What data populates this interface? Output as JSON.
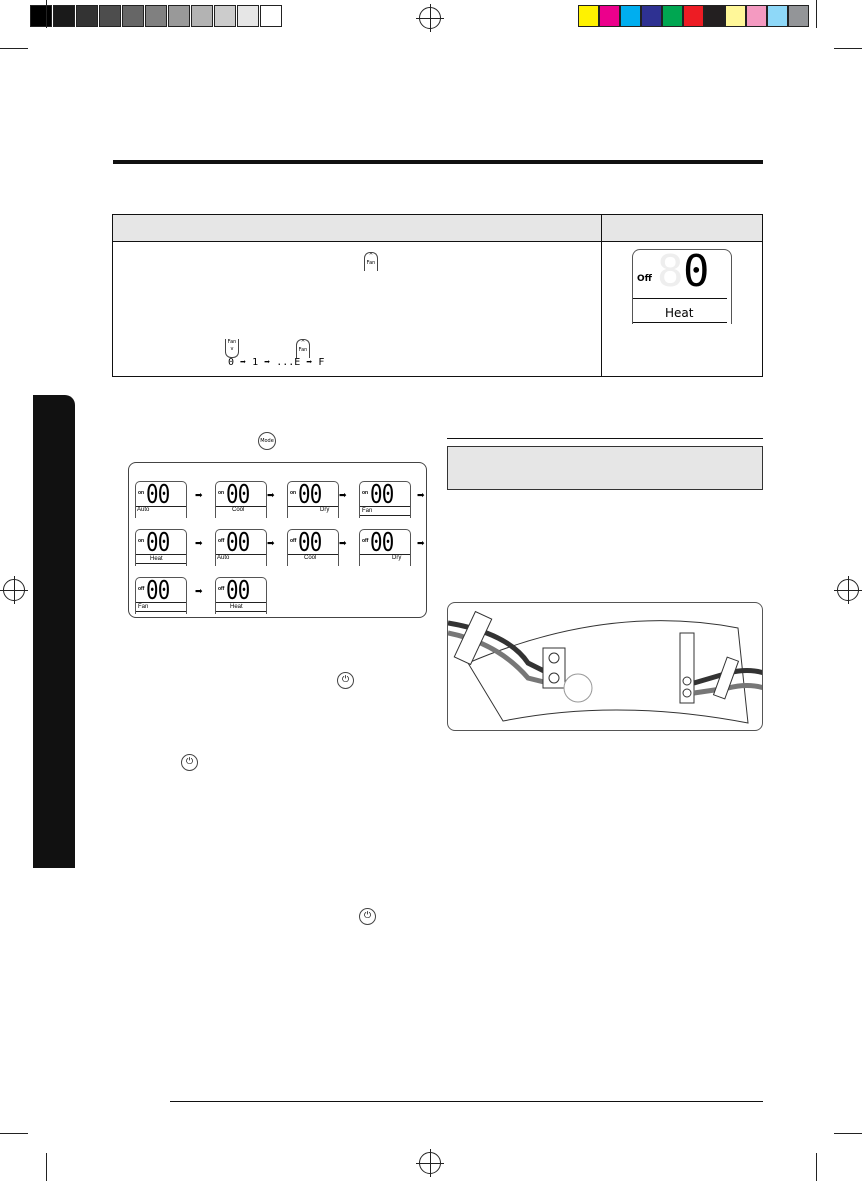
{
  "colors": {
    "gray": [
      "#000000",
      "#1a1a1a",
      "#333333",
      "#4d4d4d",
      "#666666",
      "#808080",
      "#999999",
      "#b3b3b3",
      "#cccccc",
      "#e6e6e6",
      "#ffffff"
    ],
    "process": [
      "#fff200",
      "#ec008c",
      "#00aeef",
      "#2e3192",
      "#00a651",
      "#ed1c24",
      "#231f20",
      "#fff799",
      "#f49ac1",
      "#8ed8f8",
      "#939598"
    ]
  },
  "fan_table": {
    "display": {
      "status": "Off",
      "digit": "0",
      "mode": "Heat"
    },
    "fan_up_label": "Fan",
    "fan_down_label": "Fan",
    "sequence": [
      "0",
      "1",
      "...",
      "E",
      "F"
    ]
  },
  "mode_button": {
    "label": "Mode"
  },
  "mode_sequence": [
    {
      "status": "on",
      "mode": "Auto",
      "align": "left"
    },
    {
      "status": "on",
      "mode": "Cool",
      "align": "center"
    },
    {
      "status": "on",
      "mode": "Dry",
      "align": "right"
    },
    {
      "status": "on",
      "mode": "Fan",
      "align": "left2"
    },
    {
      "status": "on",
      "mode": "Heat",
      "align": "center2"
    },
    {
      "status": "off",
      "mode": "Auto",
      "align": "left"
    },
    {
      "status": "off",
      "mode": "Cool",
      "align": "center"
    },
    {
      "status": "off",
      "mode": "Dry",
      "align": "right"
    },
    {
      "status": "off",
      "mode": "Fan",
      "align": "left2"
    },
    {
      "status": "off",
      "mode": "Heat",
      "align": "center2"
    }
  ],
  "digits": "00"
}
